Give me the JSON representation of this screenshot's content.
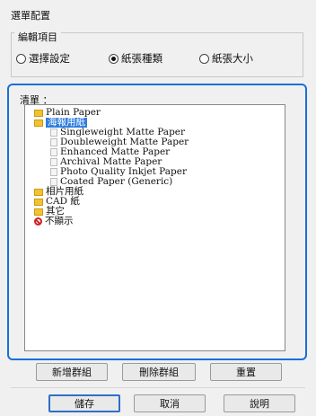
{
  "dialog": {
    "title": "選單配置"
  },
  "edit_group": {
    "label": "編輯項目",
    "options": [
      {
        "label": "選擇設定",
        "selected": false
      },
      {
        "label": "紙張種類",
        "selected": true
      },
      {
        "label": "紙張大小",
        "selected": false
      }
    ]
  },
  "list": {
    "label": "清單 ：",
    "items": [
      {
        "label": "Plain Paper",
        "icon": "folder-icon"
      },
      {
        "label": "海報用紙",
        "icon": "folder-icon",
        "selected": true
      },
      {
        "label": "Singleweight Matte Paper",
        "icon": "paper-icon"
      },
      {
        "label": "Doubleweight Matte Paper",
        "icon": "paper-icon"
      },
      {
        "label": "Enhanced Matte Paper",
        "icon": "paper-icon"
      },
      {
        "label": "Archival Matte Paper",
        "icon": "paper-icon"
      },
      {
        "label": "Photo Quality Inkjet Paper",
        "icon": "paper-icon"
      },
      {
        "label": "Coated Paper (Generic)",
        "icon": "paper-icon"
      },
      {
        "label": "相片用紙",
        "icon": "folder-icon"
      },
      {
        "label": "CAD 紙",
        "icon": "folder-icon"
      },
      {
        "label": "其它",
        "icon": "folder-icon"
      },
      {
        "label": "不顯示",
        "icon": "hidden-icon"
      }
    ]
  },
  "buttons": {
    "add_group": "新增群組",
    "delete_group": "刪除群組",
    "reset": "重置",
    "save": "儲存",
    "cancel": "取消",
    "help": "說明"
  },
  "colors": {
    "accent": "#1a6fd6",
    "selection": "#2f7ee0",
    "folder": "#f4c230",
    "hidden": "#d21f1f"
  }
}
